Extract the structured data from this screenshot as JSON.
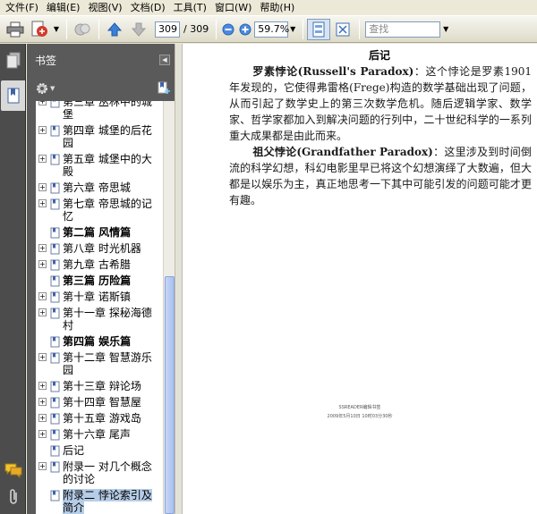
{
  "menu": {
    "items": [
      "文件(F)",
      "编辑(E)",
      "视图(V)",
      "文档(D)",
      "工具(T)",
      "窗口(W)",
      "帮助(H)"
    ]
  },
  "toolbar": {
    "page_current": "309",
    "page_total": "/ 309",
    "zoom": "59.7%",
    "search_placeholder": "查找"
  },
  "nav": {
    "title": "书签",
    "items": [
      {
        "label": "第三章 丛林中的城堡",
        "bold": false,
        "expandable": true
      },
      {
        "label": "第四章 城堡的后花园",
        "bold": false,
        "expandable": true
      },
      {
        "label": "第五章 城堡中的大殿",
        "bold": false,
        "expandable": true
      },
      {
        "label": "第六章 帝思城",
        "bold": false,
        "expandable": true
      },
      {
        "label": "第七章 帝思城的记忆",
        "bold": false,
        "expandable": true
      },
      {
        "label": "第二篇 风情篇",
        "bold": true,
        "expandable": false
      },
      {
        "label": "第八章 时光机器",
        "bold": false,
        "expandable": true
      },
      {
        "label": "第九章 古希腊",
        "bold": false,
        "expandable": true
      },
      {
        "label": "第三篇 历险篇",
        "bold": true,
        "expandable": false
      },
      {
        "label": "第十章 诺斯镇",
        "bold": false,
        "expandable": true
      },
      {
        "label": "第十一章 探秘海德村",
        "bold": false,
        "expandable": true
      },
      {
        "label": "第四篇 娱乐篇",
        "bold": true,
        "expandable": false
      },
      {
        "label": "第十二章 智慧游乐园",
        "bold": false,
        "expandable": true
      },
      {
        "label": "第十三章 辩论场",
        "bold": false,
        "expandable": true
      },
      {
        "label": "第十四章 智慧屋",
        "bold": false,
        "expandable": true
      },
      {
        "label": "第十五章 游戏岛",
        "bold": false,
        "expandable": true
      },
      {
        "label": "第十六章 尾声",
        "bold": false,
        "expandable": true
      },
      {
        "label": "后记",
        "bold": false,
        "expandable": false
      },
      {
        "label": "附录一 对几个概念的讨论",
        "bold": false,
        "expandable": true
      },
      {
        "label": "附录二 悖论索引及简介",
        "bold": false,
        "expandable": false,
        "selected": true
      }
    ]
  },
  "document": {
    "title": "后记",
    "p1_lead": "罗素悖论(Russell's Paradox)",
    "p1_body": "：这个悖论是罗素1901年发现的，它使得弗雷格(Frege)构造的数学基础出现了问题，从而引起了数学史上的第三次数学危机。随后逻辑学家、数学家、哲学家都加入到解决问题的行列中，二十世纪科学的一系列重大成果都是由此而来。",
    "p2_lead": "祖父悖论(Grandfather Paradox)",
    "p2_body": "：这里涉及到时间倒流的科学幻想，科幻电影里早已将这个幻想演绎了大数遍，但大都是以娱乐为主，真正地思考一下其中可能引发的问题可能才更有趣。",
    "footer1": "SSREADER编辑书签",
    "footer2": "2009年5月10日 10时03分30秒"
  }
}
